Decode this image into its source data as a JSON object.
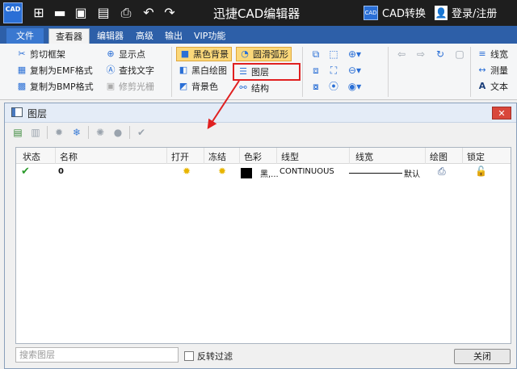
{
  "titlebar": {
    "app_icon_text": "CAD",
    "title": "迅捷CAD编辑器",
    "cad_convert": "CAD转换",
    "cad_convert_icon_text": "CAD",
    "login": "登录/注册",
    "quick_access": [
      "add-icon",
      "open-folder-icon",
      "save-icon",
      "save-as-icon",
      "print-icon",
      "undo-icon",
      "redo-icon"
    ]
  },
  "tabs": [
    "文件",
    "查看器",
    "编辑器",
    "高级",
    "输出",
    "VIP功能"
  ],
  "ribbon": {
    "group1": [
      "剪切框架",
      "复制为EMF格式",
      "复制为BMP格式"
    ],
    "group2": [
      "显示点",
      "查找文字",
      "修剪光栅"
    ],
    "group3": [
      "黑色背景",
      "黑白绘图",
      "背景色"
    ],
    "group4": [
      "圆滑弧形",
      "图层",
      "结构"
    ],
    "right": [
      "线宽",
      "测量",
      "文本"
    ]
  },
  "dialog": {
    "title": "图层",
    "close_glyph": "✕",
    "columns": [
      "状态",
      "名称",
      "打开",
      "冻结",
      "色彩",
      "线型",
      "线宽",
      "绘图",
      "锁定"
    ],
    "rows": [
      {
        "status": "✔",
        "name": "0",
        "color_name": "黑,...",
        "color_hex": "#000000",
        "linetype": "CONTINUOUS",
        "lineweight": "默认"
      }
    ],
    "search_placeholder": "搜索图层",
    "invert_filter": "反转过滤",
    "close_button": "关闭"
  },
  "colors": {
    "ribbon_tab_bg": "#2d5fa8",
    "highlight_box": "#e02020",
    "annotation_arrow": "#e02020"
  }
}
